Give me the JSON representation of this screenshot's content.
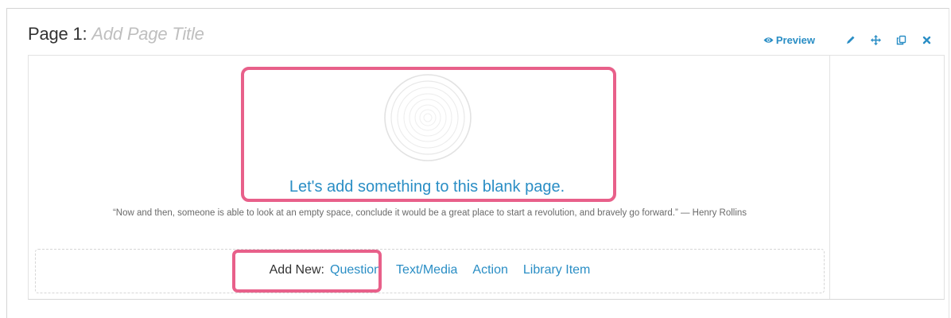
{
  "page": {
    "label": "Page 1:",
    "title_placeholder": "Add Page Title"
  },
  "toolbar": {
    "preview_label": "Preview",
    "icons": [
      "eye-icon",
      "pencil-icon",
      "move-icon",
      "copy-icon",
      "close-icon"
    ]
  },
  "content": {
    "blank_message": "Let's add something to this blank page.",
    "quote": "“Now and then, someone is able to look at an empty space, conclude it would be a great place to start a revolution, and bravely go forward.” — Henry Rollins"
  },
  "add_new": {
    "label": "Add New:",
    "options": [
      "Question",
      "Text/Media",
      "Action",
      "Library Item"
    ]
  },
  "colors": {
    "link": "#2a8ec5",
    "highlight": "#e8608a",
    "placeholder": "#bfbfbf"
  }
}
